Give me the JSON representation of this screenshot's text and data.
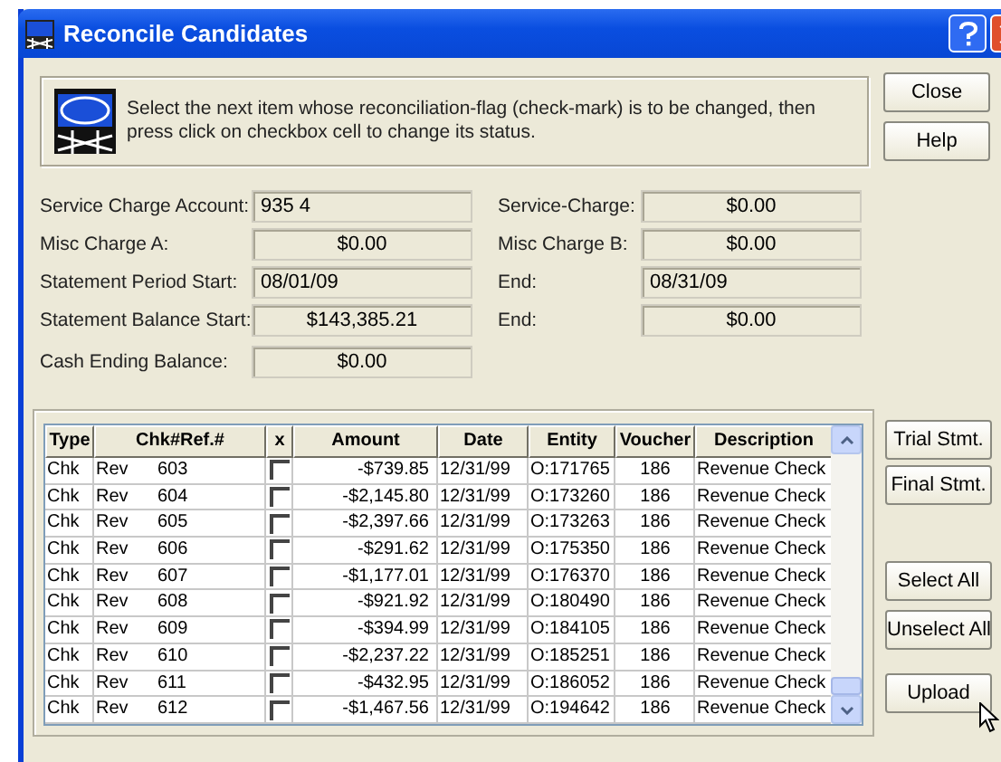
{
  "window": {
    "title": "Reconcile Candidates"
  },
  "info": {
    "message": "Select the next item whose reconciliation-flag (check-mark) is to be changed, then press click on checkbox cell to change its status."
  },
  "top_buttons": [
    "Close",
    "Help"
  ],
  "fields_left": [
    {
      "label": "Service Charge Account:",
      "value": "935  4",
      "kind": "text"
    },
    {
      "label": "Misc Charge A:",
      "value": "$0.00",
      "kind": "amount"
    },
    {
      "label": "Statement Period Start:",
      "value": "08/01/09",
      "kind": "text"
    },
    {
      "label": "Statement Balance Start:",
      "value": "$143,385.21",
      "kind": "amount"
    },
    {
      "label": "Cash Ending Balance:",
      "value": "$0.00",
      "kind": "amount"
    }
  ],
  "fields_right": [
    {
      "label": "Service-Charge:",
      "value": "$0.00",
      "kind": "amount"
    },
    {
      "label": "Misc Charge B:",
      "value": "$0.00",
      "kind": "amount"
    },
    {
      "label": "End:",
      "value": "08/31/09",
      "kind": "text"
    },
    {
      "label": "End:",
      "value": "$0.00",
      "kind": "amount"
    }
  ],
  "table": {
    "columns": [
      "Type",
      "Chk#Ref.#",
      "x",
      "Amount",
      "Date",
      "Entity",
      "Voucher",
      "Description"
    ],
    "rows": [
      {
        "type": "Chk",
        "ref": "Rev",
        "number": "603",
        "checked": false,
        "amount": "-$739.85",
        "date": "12/31/99",
        "entity": "O:171765",
        "voucher": "186",
        "description": "Revenue Check"
      },
      {
        "type": "Chk",
        "ref": "Rev",
        "number": "604",
        "checked": false,
        "amount": "-$2,145.80",
        "date": "12/31/99",
        "entity": "O:173260",
        "voucher": "186",
        "description": "Revenue Check"
      },
      {
        "type": "Chk",
        "ref": "Rev",
        "number": "605",
        "checked": false,
        "amount": "-$2,397.66",
        "date": "12/31/99",
        "entity": "O:173263",
        "voucher": "186",
        "description": "Revenue Check"
      },
      {
        "type": "Chk",
        "ref": "Rev",
        "number": "606",
        "checked": false,
        "amount": "-$291.62",
        "date": "12/31/99",
        "entity": "O:175350",
        "voucher": "186",
        "description": "Revenue Check"
      },
      {
        "type": "Chk",
        "ref": "Rev",
        "number": "607",
        "checked": false,
        "amount": "-$1,177.01",
        "date": "12/31/99",
        "entity": "O:176370",
        "voucher": "186",
        "description": "Revenue Check"
      },
      {
        "type": "Chk",
        "ref": "Rev",
        "number": "608",
        "checked": false,
        "amount": "-$921.92",
        "date": "12/31/99",
        "entity": "O:180490",
        "voucher": "186",
        "description": "Revenue Check"
      },
      {
        "type": "Chk",
        "ref": "Rev",
        "number": "609",
        "checked": false,
        "amount": "-$394.99",
        "date": "12/31/99",
        "entity": "O:184105",
        "voucher": "186",
        "description": "Revenue Check"
      },
      {
        "type": "Chk",
        "ref": "Rev",
        "number": "610",
        "checked": false,
        "amount": "-$2,237.22",
        "date": "12/31/99",
        "entity": "O:185251",
        "voucher": "186",
        "description": "Revenue Check"
      },
      {
        "type": "Chk",
        "ref": "Rev",
        "number": "611",
        "checked": false,
        "amount": "-$432.95",
        "date": "12/31/99",
        "entity": "O:186052",
        "voucher": "186",
        "description": "Revenue Check"
      },
      {
        "type": "Chk",
        "ref": "Rev",
        "number": "612",
        "checked": false,
        "amount": "-$1,467.56",
        "date": "12/31/99",
        "entity": "O:194642",
        "voucher": "186",
        "description": "Revenue Check"
      }
    ]
  },
  "side_buttons": [
    "Trial Stmt.",
    "Final Stmt.",
    "Select All",
    "Unselect All",
    "Upload"
  ]
}
